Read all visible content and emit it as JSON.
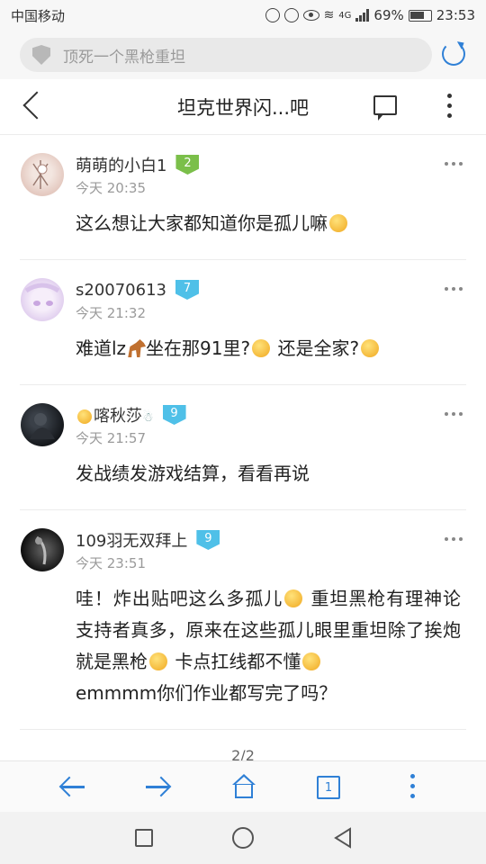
{
  "status": {
    "carrier": "中国移动",
    "network": "4G",
    "battery": "69%",
    "time": "23:53"
  },
  "browser": {
    "url_placeholder": "顶死一个黑枪重坦",
    "accent": "#2f80d6"
  },
  "header": {
    "title": "坦克世界闪...吧"
  },
  "posts": [
    {
      "username": "萌萌的小白1",
      "level": "2",
      "level_color": "#7bbf4a",
      "time": "今天 20:35",
      "text": "这么想让大家都知道你是孤儿嘛"
    },
    {
      "username": "s20070613",
      "level": "7",
      "level_color": "#4fc0e8",
      "time": "今天 21:32",
      "text_a": "难道lz",
      "text_b": "坐在那91里?",
      "text_c": " 还是全家?"
    },
    {
      "username": "喀秋莎",
      "level": "9",
      "level_color": "#4fc0e8",
      "time": "今天 21:57",
      "text": "发战绩发游戏结算，看看再说"
    },
    {
      "username": "109羽无双拜上",
      "level": "9",
      "level_color": "#4fc0e8",
      "time": "今天 23:51",
      "text_a": "哇！炸出贴吧这么多孤儿",
      "text_b": " 重坦黑枪有理神论支持者真多，原来在这些孤儿眼里重坦除了挨炮就是黑枪",
      "text_c": " 卡点扛线都不懂",
      "text_d": "emmmm你们作业都写完了吗？"
    }
  ],
  "pager": {
    "label": "2/2"
  },
  "bottombar": {
    "tabs_count": "1"
  }
}
